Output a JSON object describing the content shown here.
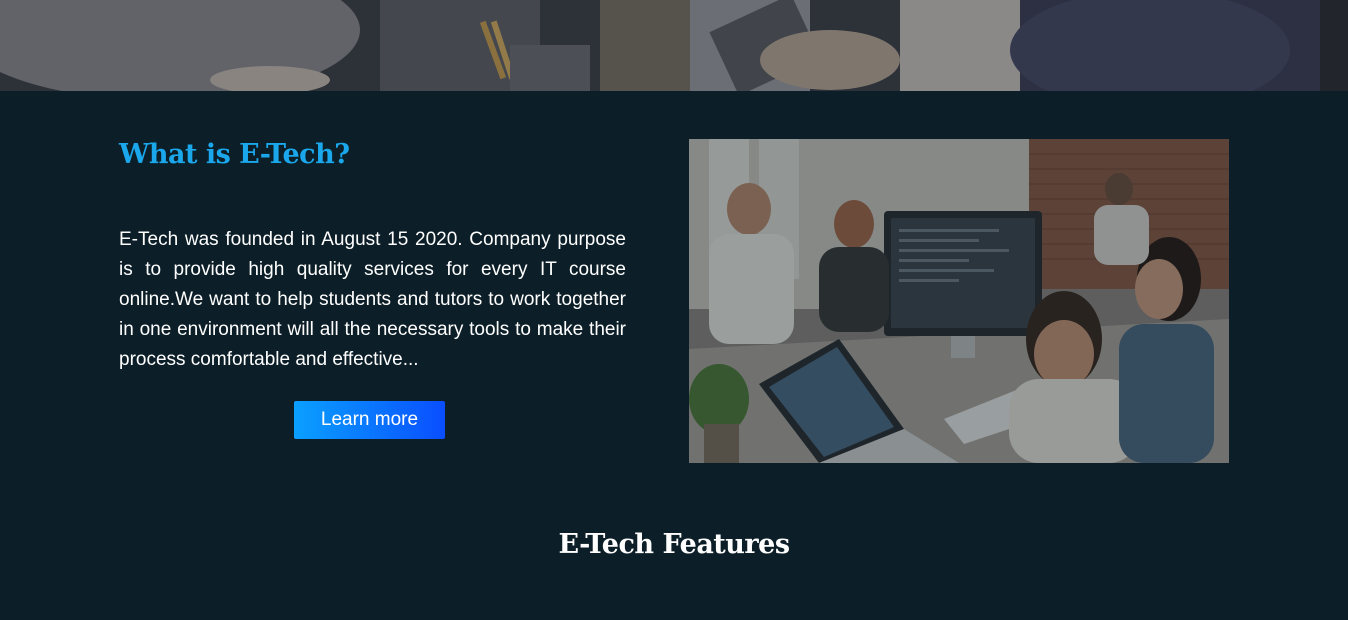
{
  "hero": {
    "image": "office-team-banner"
  },
  "about": {
    "title": "What is E-Tech?",
    "text": "E-Tech was founded in August 15 2020. Company purpose is to provide high quality services for every IT course online.We want to help students and tutors to work together in one environment will all the necessary tools to make their process comfortable and effective...",
    "button_label": "Learn more",
    "image": "team-working-at-computers-photo"
  },
  "features": {
    "title": "E-Tech Features"
  },
  "colors": {
    "background": "#0c1e27",
    "accent": "#1aa7ec",
    "button_gradient_start": "#0aa0ff",
    "button_gradient_end": "#0a4eff"
  }
}
